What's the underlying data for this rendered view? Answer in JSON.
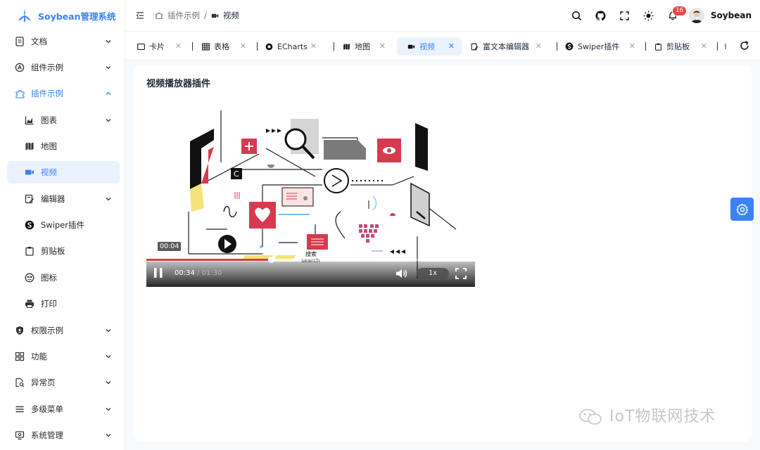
{
  "app": {
    "name": "Soybean管理系统"
  },
  "sidebar": {
    "items": [
      {
        "label": "文档"
      },
      {
        "label": "组件示例"
      },
      {
        "label": "插件示例"
      },
      {
        "label": "图表"
      },
      {
        "label": "地图"
      },
      {
        "label": "视频"
      },
      {
        "label": "编辑器"
      },
      {
        "label": "Swiper插件"
      },
      {
        "label": "剪贴板"
      },
      {
        "label": "图标"
      },
      {
        "label": "打印"
      },
      {
        "label": "权限示例"
      },
      {
        "label": "功能"
      },
      {
        "label": "异常页"
      },
      {
        "label": "多级菜单"
      },
      {
        "label": "系统管理"
      }
    ]
  },
  "header": {
    "breadcrumb": [
      "插件示例",
      "/",
      "视频"
    ],
    "notification_count": "16",
    "username": "Soybean"
  },
  "tabs": [
    {
      "label": "卡片"
    },
    {
      "label": "表格"
    },
    {
      "label": "ECharts"
    },
    {
      "label": "地图"
    },
    {
      "label": "视频"
    },
    {
      "label": "富文本编辑器"
    },
    {
      "label": "Swiper插件"
    },
    {
      "label": "剪贴板"
    }
  ],
  "main": {
    "title": "视频播放器插件",
    "player": {
      "hover_time": "00:04",
      "current_time": "00:34",
      "separator": " / ",
      "duration": "01:30",
      "speed": "1x",
      "progress": 0.38,
      "buffered": 0.45,
      "scene_text_cn": "搜索",
      "scene_text_en": "search"
    }
  },
  "watermark": "IoT物联网技术",
  "colors": {
    "primary": "#3b82f6",
    "active_bg": "#eaf2ff",
    "progress": "#e53935",
    "scene_red": "#d63a4f"
  }
}
